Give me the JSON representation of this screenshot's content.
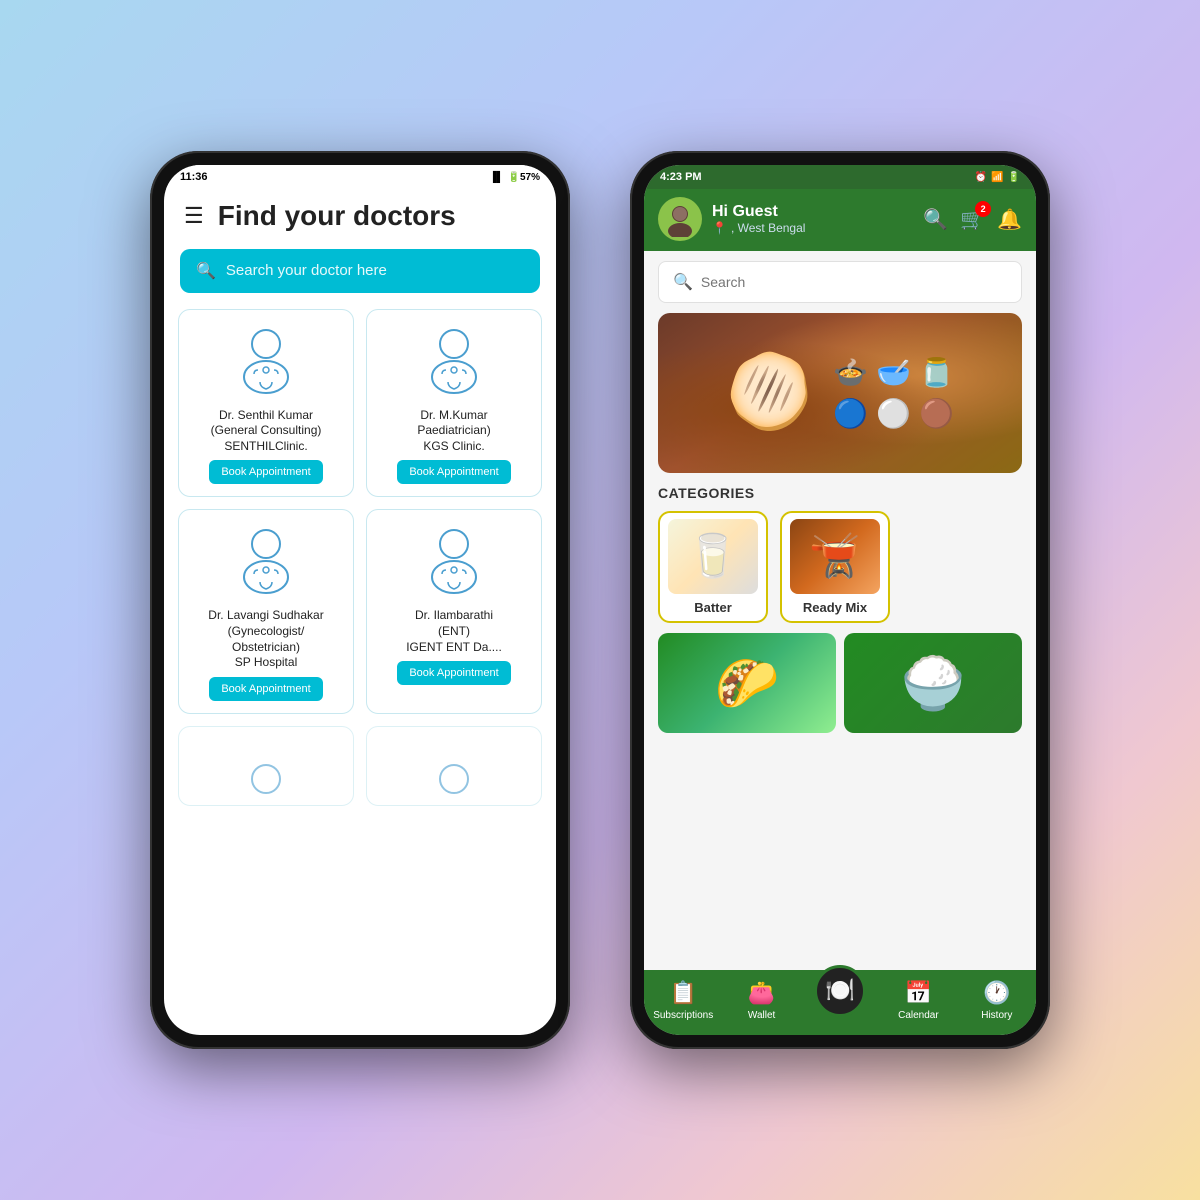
{
  "background": {
    "gradient": "linear-gradient(135deg, #a8d8f0, #b8c8f8, #d0b8f0, #f0c8d0, #f8e0a0)"
  },
  "left_phone": {
    "status_bar": {
      "time": "11:36",
      "icons": "VoLTE 4G LTE2 57%"
    },
    "title": "Find your doctors",
    "search_placeholder": "Search your doctor here",
    "doctors": [
      {
        "name": "Dr. Senthil Kumar\n(General Consulting)\nSENTHILClinic.",
        "book_label": "Book Appointment",
        "specialty": "General Consulting"
      },
      {
        "name": "Dr. M.Kumar\nPaediatrician)\nKGS Clinic.",
        "book_label": "Book Appointment",
        "specialty": "Paediatrician"
      },
      {
        "name": "Dr. Lavangi Sudhakar\n(Gynecologist/\nObstetrician)\nSP Hospital",
        "book_label": "Book Appointment",
        "specialty": "Gynecologist"
      },
      {
        "name": "Dr. Ilambarathi\n(ENT)\nIGENT ENT Da....",
        "book_label": "Book Appointment",
        "specialty": "ENT"
      }
    ]
  },
  "right_phone": {
    "status_bar": {
      "time": "4:23 PM",
      "icons": "wifi signal battery"
    },
    "header": {
      "greeting": "Hi Guest",
      "location": ", West Bengal",
      "cart_count": "2"
    },
    "search_placeholder": "Search",
    "banner_emoji": "🫓",
    "categories_title": "CATEGORIES",
    "categories": [
      {
        "name": "Batter",
        "type": "batter"
      },
      {
        "name": "Ready Mix",
        "type": "readymix"
      }
    ],
    "bottom_nav": [
      {
        "label": "Subscriptions",
        "icon": "📋"
      },
      {
        "label": "Wallet",
        "icon": "👛"
      },
      {
        "label": "",
        "icon": "🏠",
        "is_home": true
      },
      {
        "label": "Calendar",
        "icon": "📅"
      },
      {
        "label": "History",
        "icon": "🕐"
      }
    ]
  }
}
